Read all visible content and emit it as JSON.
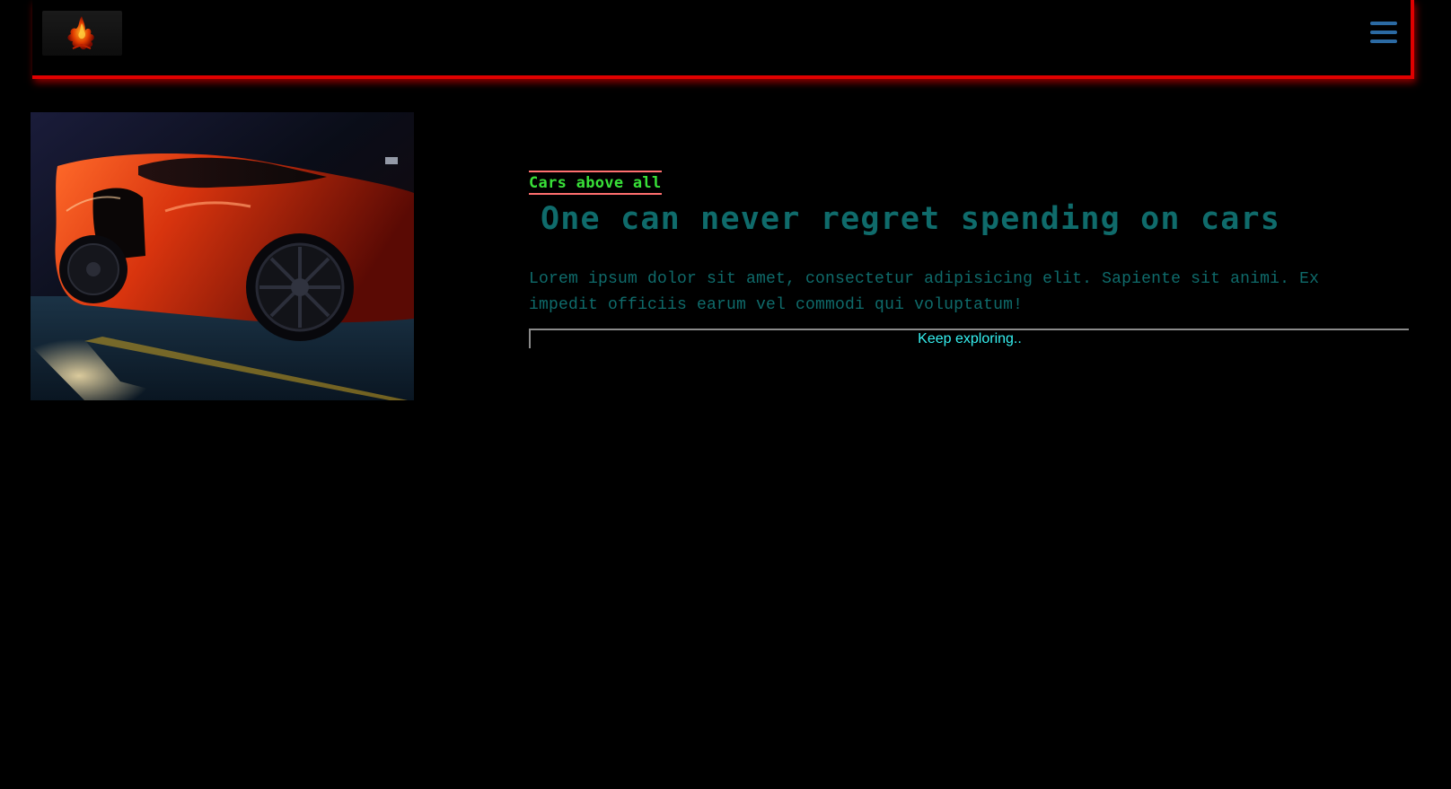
{
  "header": {
    "menu_icon": "hamburger-menu-icon",
    "logo_icon": "phoenix-logo-icon",
    "accent_color": "#e00000"
  },
  "hero": {
    "image_icon": "red-sports-car-photo",
    "tagline": "Cars above all",
    "headline": "One can never regret spending on cars",
    "body": "Lorem ipsum dolor sit amet, consectetur adipisicing elit. Sapiente sit animi. Ex impedit officiis earum vel commodi qui voluptatum!",
    "button_label": "Keep exploring.."
  },
  "colors": {
    "background": "#000000",
    "tagline": "#38e038",
    "tagline_border": "#ff6f6f",
    "headline": "#0f6b6b",
    "button_text": "#35f0f0",
    "menu_icon": "#2b6aa3"
  }
}
